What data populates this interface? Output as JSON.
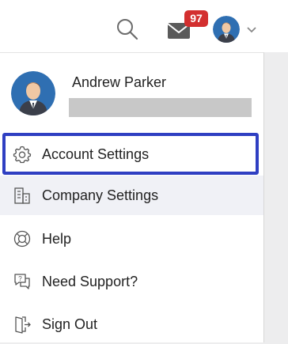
{
  "header": {
    "search_icon": "search-icon",
    "mail_icon": "mail-icon",
    "mail_badge": "97",
    "badge_color": "#d32f2f",
    "dropdown_icon": "chevron-down-icon"
  },
  "profile": {
    "name": "Andrew Parker"
  },
  "menu": {
    "items": [
      {
        "label": "Account Settings",
        "icon": "gear-icon"
      },
      {
        "label": "Company Settings",
        "icon": "building-icon"
      },
      {
        "label": "Help",
        "icon": "lifebuoy-icon"
      },
      {
        "label": "Need Support?",
        "icon": "support-chat-icon"
      },
      {
        "label": "Sign Out",
        "icon": "sign-out-icon"
      }
    ]
  },
  "colors": {
    "highlight": "#2f3fc2",
    "hover_bg": "#f0f1f6"
  }
}
